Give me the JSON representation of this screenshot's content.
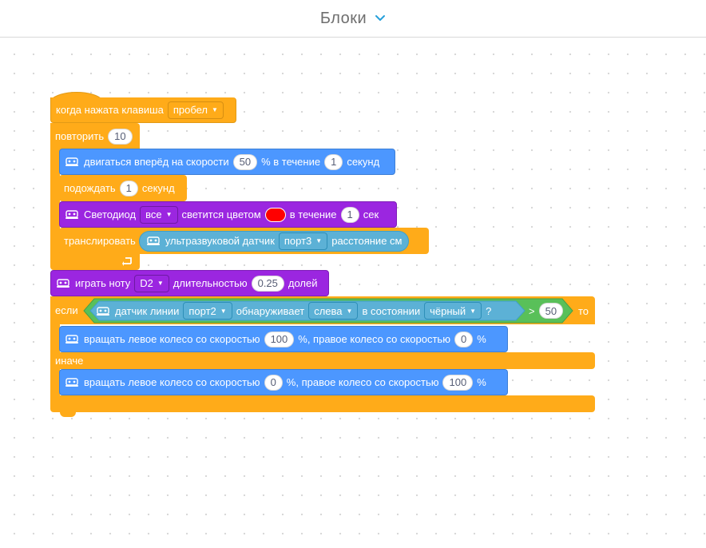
{
  "header": {
    "title": "Блоки",
    "chevron_icon": "chevron-down-icon",
    "chevron_color": "#26A0DA"
  },
  "colors": {
    "events": "#FFAB19",
    "motion": "#4C97FF",
    "looks": "#9B26E0",
    "sensing": "#5CB1D6",
    "operators": "#59C059"
  },
  "blocks": {
    "hat": {
      "label": "когда нажата клавиша",
      "key": "пробел"
    },
    "repeat": {
      "label": "повторить",
      "count": "10"
    },
    "move": {
      "label": "двигаться вперёд на скорости",
      "speed": "50",
      "mid": "% в течение",
      "time": "1",
      "unit": "секунд"
    },
    "wait": {
      "label": "подождать",
      "time": "1",
      "unit": "секунд"
    },
    "led": {
      "label": "Светодиод",
      "which": "все",
      "mid": "светится цветом",
      "color": "#ff0000",
      "mid2": "в течение",
      "time": "1",
      "unit": "сек"
    },
    "broadcast": {
      "label": "транслировать"
    },
    "ultrasonic": {
      "label": "ультразвуковой датчик",
      "port": "порт3",
      "tail": "расстояние см"
    },
    "play_note": {
      "label": "играть ноту",
      "note": "D2",
      "mid": "длительностью",
      "beats": "0.25",
      "unit": "долей"
    },
    "if_else": {
      "if_label": "если",
      "then_label": "то",
      "else_label": "иначе",
      "line_sensor": {
        "label": "датчик линии",
        "port": "порт2",
        "mid": "обнаруживает",
        "side": "слева",
        "mid2": "в состоянии",
        "state": "чёрный",
        "q": "?"
      },
      "compare": {
        "op": ">",
        "value": "50"
      }
    },
    "wheels_1": {
      "label": "вращать левое колесо со скоростью",
      "left": "100",
      "mid": "%, правое колесо со скоростью",
      "right": "0",
      "unit": "%"
    },
    "wheels_2": {
      "label": "вращать левое колесо со скоростью",
      "left": "0",
      "mid": "%, правое колесо со скоростью",
      "right": "100",
      "unit": "%"
    }
  }
}
